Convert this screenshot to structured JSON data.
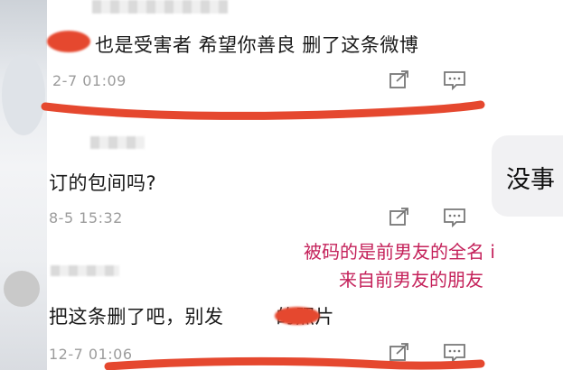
{
  "comments": [
    {
      "text": "也是受害者 希望你善良 删了这条微博",
      "time": "2-7 01:09"
    },
    {
      "text": "订的包间吗?",
      "time": "8-5 15:32"
    },
    {
      "text": "把这条删了吧，别发",
      "text_after": "的照片",
      "time": "12-7 01:06"
    }
  ],
  "right_bubble": {
    "text": "没事"
  },
  "annotation": {
    "line1": "被码的是前男友的全名 i",
    "line2": "来自前男友的朋友"
  },
  "colors": {
    "annotation": "#c4215a",
    "redaction": "#e5482f",
    "time": "#9c9c9c"
  },
  "icons": [
    "share-icon",
    "comment-icon"
  ]
}
